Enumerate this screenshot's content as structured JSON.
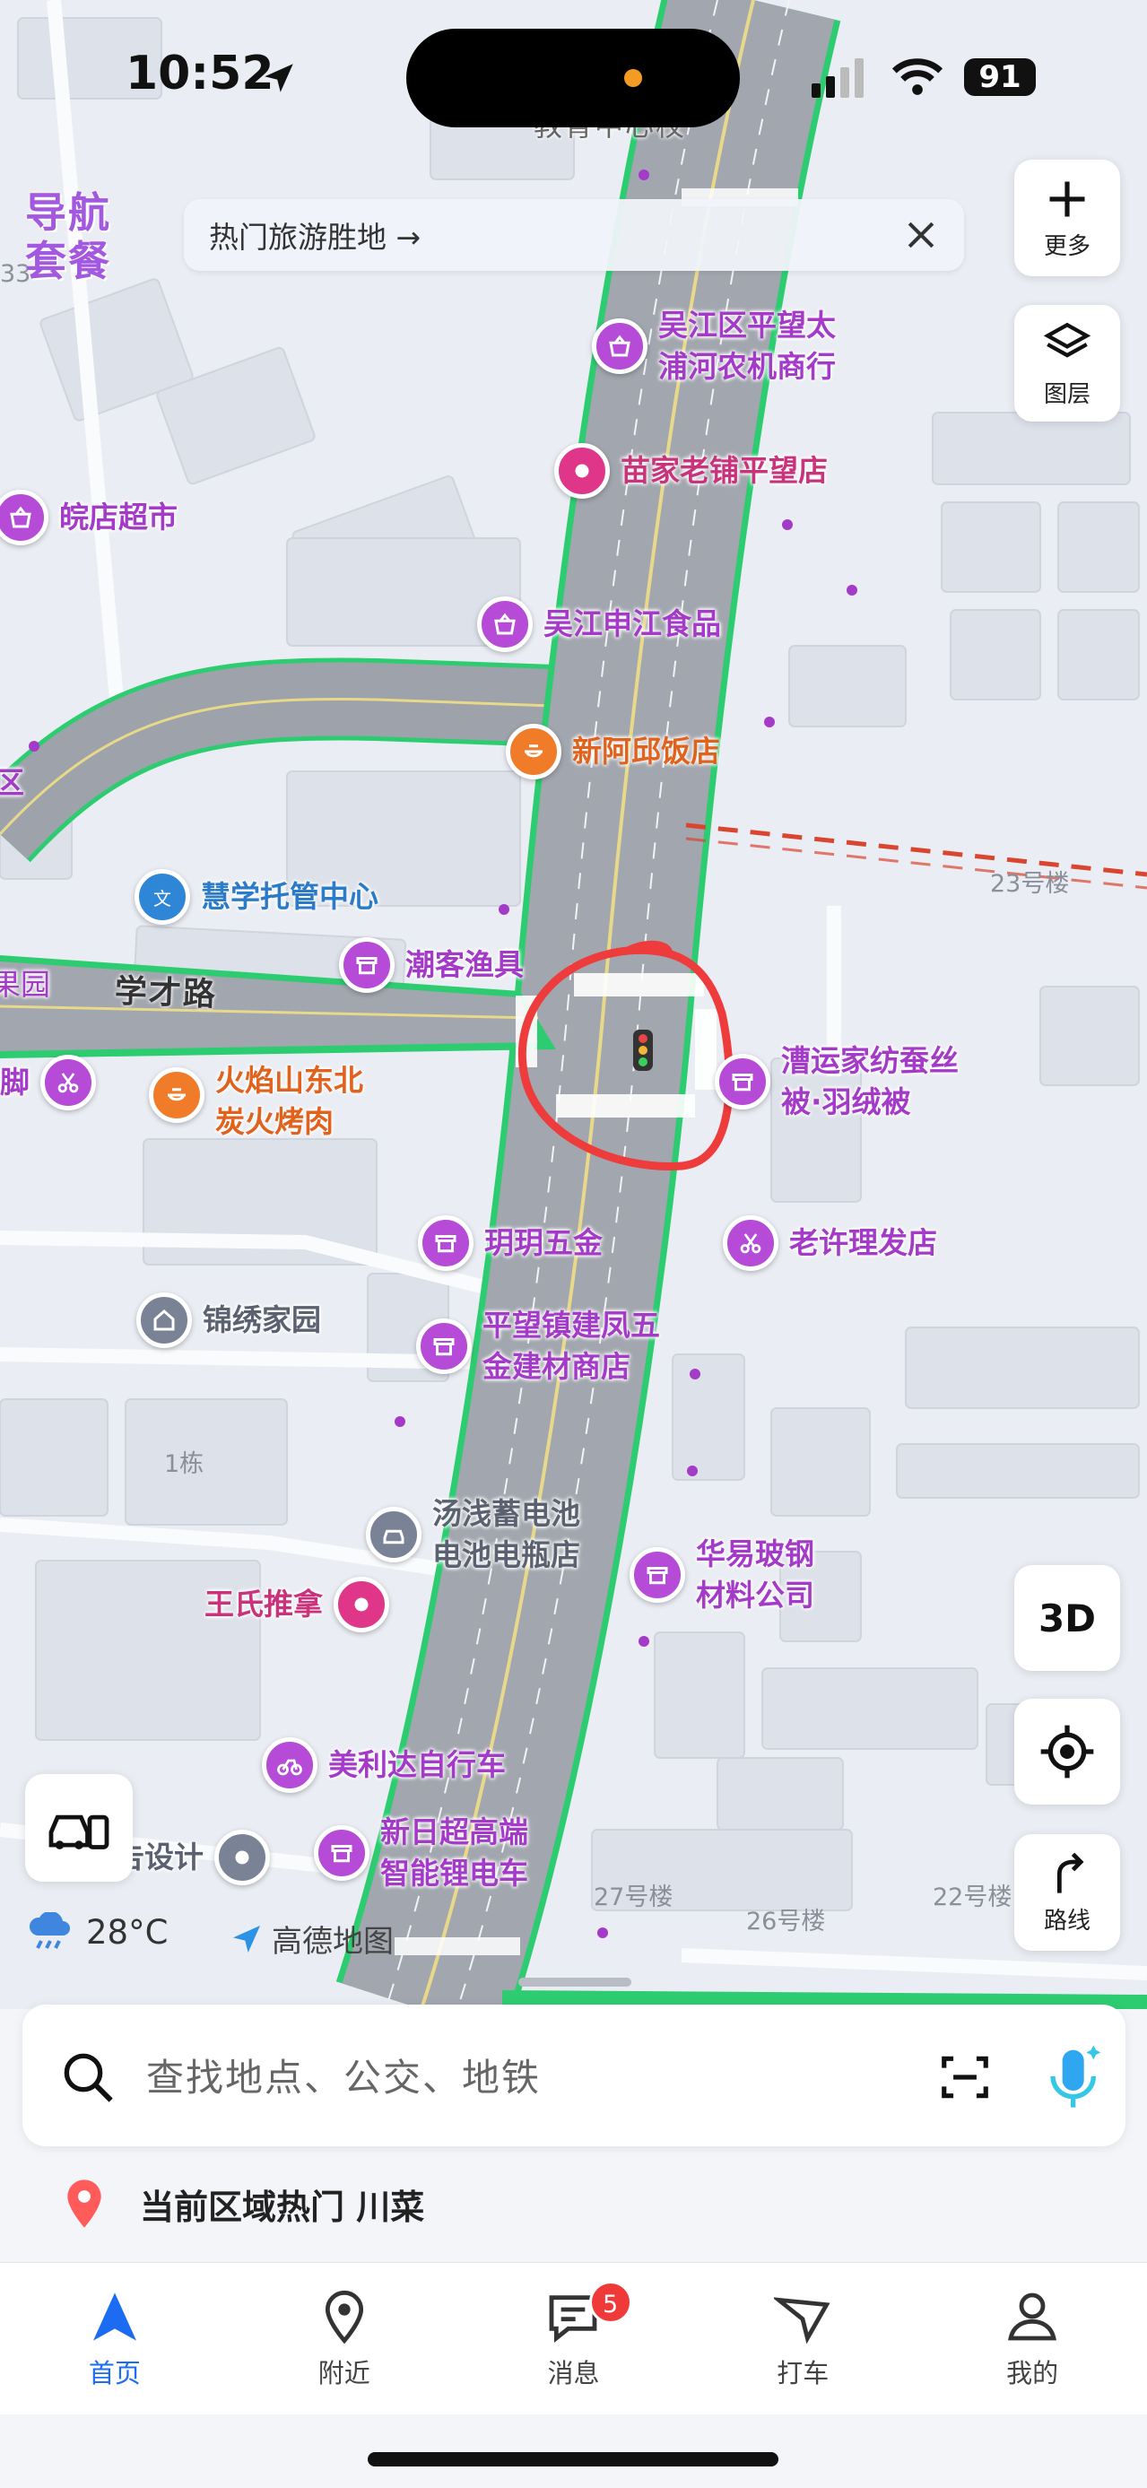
{
  "status_bar": {
    "time": "10:52",
    "battery": "91"
  },
  "brand": {
    "line1": "导航",
    "line2": "套餐"
  },
  "banner": {
    "text": "热门旅游胜地 →"
  },
  "map_controls": {
    "more_label": "更多",
    "layers_label": "图层",
    "three_d_label": "3D",
    "route_label": "路线"
  },
  "map": {
    "road_labels": {
      "xuecai_road": "学才路"
    },
    "building_labels": {
      "b23": "23号楼",
      "b27": "27号楼",
      "b26": "26号楼",
      "b22": "22号楼",
      "b1": "1栋",
      "b33": "33"
    },
    "pois": {
      "wujiang_market": "吴江区平望太\n浦河农机商行",
      "miaojia": "苗家老铺平望店",
      "wandian": "皖店超市",
      "shenjiang": "吴江申江食品",
      "xinaqiu": "新阿邱饭店",
      "huixue": "慧学托管中心",
      "chaoke": "潮客渔具",
      "guoyuan": "果园",
      "jiao": "脚",
      "huoyan": "火焰山东北\n炭火烤肉",
      "caoyun": "漕运家纺蚕丝\n被·羽绒被",
      "yueyue": "玥玥五金",
      "laoxu": "老许理发店",
      "jinxiu": "锦绣家园",
      "pingwang_hw": "平望镇建凤五\n金建材商店",
      "tangqian": "汤浅蓄电池\n电池电瓶店",
      "huayi": "华易玻钢\n材料公司",
      "wangshi": "王氏推拿",
      "meilida": "美利达自行车",
      "gaosheji": "告设计",
      "xinri": "新日超高端\n智能锂电车",
      "qu": "区",
      "top_cut": "教育中心校"
    }
  },
  "weather": {
    "temp": "28°C",
    "brand": "高德地图"
  },
  "search": {
    "placeholder": "查找地点、公交、地铁"
  },
  "hot": {
    "text": "当前区域热门 川菜"
  },
  "tabs": [
    {
      "label": "首页"
    },
    {
      "label": "附近"
    },
    {
      "label": "消息",
      "badge": "5"
    },
    {
      "label": "打车"
    },
    {
      "label": "我的"
    }
  ],
  "colors": {
    "accent": "#1b6cf2",
    "poi_purple": "#b54bd6",
    "road_edge": "#2ecc71",
    "annotation": "#ee3b3b"
  }
}
